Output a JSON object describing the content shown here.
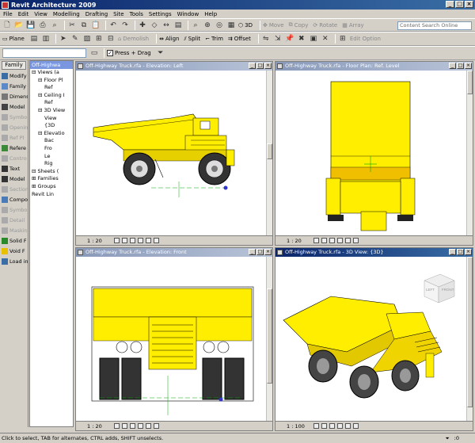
{
  "window": {
    "title": "Revit Architecture 2009"
  },
  "menu": [
    "File",
    "Edit",
    "View",
    "Modelling",
    "Drafting",
    "Site",
    "Tools",
    "Settings",
    "Window",
    "Help"
  ],
  "toolbar1": {
    "view_3d_label": "3D",
    "move_label": "Move",
    "copy_label": "Copy",
    "rotate_label": "Rotate",
    "array_label": "Array",
    "search_placeholder": "Content Search Online"
  },
  "toolbar2": {
    "plane_label": "Plane",
    "demolish_label": "Demolish",
    "align_label": "Align",
    "split_label": "Split",
    "trim_label": "Trim",
    "offset_label": "Offset",
    "edit_option_label": "Edit Option"
  },
  "toolbar3": {
    "press_drag_label": "Press + Drag"
  },
  "design_bar": {
    "tab": "Family",
    "items": [
      {
        "label": "Modify",
        "disabled": false,
        "color": "#3a6ea5"
      },
      {
        "label": "Family",
        "disabled": false,
        "color": "#5a8ac8"
      },
      {
        "label": "Dimens",
        "disabled": false,
        "color": "#777"
      },
      {
        "label": "Model",
        "disabled": false,
        "color": "#444"
      },
      {
        "label": "Symbo",
        "disabled": true,
        "color": "#aaa"
      },
      {
        "label": "Opening",
        "disabled": true,
        "color": "#aaa"
      },
      {
        "label": "Ref Pl",
        "disabled": true,
        "color": "#aaa"
      },
      {
        "label": "Refere",
        "disabled": false,
        "color": "#3a8a3a"
      },
      {
        "label": "Contro",
        "disabled": true,
        "color": "#aaa"
      },
      {
        "label": "Text",
        "disabled": false,
        "color": "#333"
      },
      {
        "label": "Model",
        "disabled": false,
        "color": "#333"
      },
      {
        "label": "Section",
        "disabled": true,
        "color": "#aaa"
      },
      {
        "label": "Compo",
        "disabled": false,
        "color": "#4a7ab8"
      },
      {
        "label": "Symbo",
        "disabled": true,
        "color": "#aaa"
      },
      {
        "label": "Detail",
        "disabled": true,
        "color": "#aaa"
      },
      {
        "label": "Maskin",
        "disabled": true,
        "color": "#aaa"
      },
      {
        "label": "Solid F",
        "disabled": false,
        "color": "#2a8a2a"
      },
      {
        "label": "Void F",
        "disabled": false,
        "color": "#e8c000"
      },
      {
        "label": "Load in",
        "disabled": false,
        "color": "#3a6ea5"
      }
    ]
  },
  "project_browser": {
    "title": "Off-Highwa",
    "tree": [
      {
        "label": "Views (a",
        "depth": 0,
        "marker": "⊟"
      },
      {
        "label": "Floor Pl",
        "depth": 1,
        "marker": "⊟"
      },
      {
        "label": "Ref",
        "depth": 2,
        "marker": ""
      },
      {
        "label": "Ceiling I",
        "depth": 1,
        "marker": "⊟"
      },
      {
        "label": "Ref",
        "depth": 2,
        "marker": ""
      },
      {
        "label": "3D View",
        "depth": 1,
        "marker": "⊟"
      },
      {
        "label": "View",
        "depth": 2,
        "marker": ""
      },
      {
        "label": "{3D",
        "depth": 2,
        "marker": ""
      },
      {
        "label": "Elevatio",
        "depth": 1,
        "marker": "⊟"
      },
      {
        "label": "Bac",
        "depth": 2,
        "marker": ""
      },
      {
        "label": "Fro",
        "depth": 2,
        "marker": ""
      },
      {
        "label": "Le",
        "depth": 2,
        "marker": ""
      },
      {
        "label": "Rig",
        "depth": 2,
        "marker": ""
      },
      {
        "label": "Sheets (",
        "depth": 0,
        "marker": "⊟"
      },
      {
        "label": "Families",
        "depth": 0,
        "marker": "⊞"
      },
      {
        "label": "Groups",
        "depth": 0,
        "marker": "⊞"
      },
      {
        "label": "Revit Lin",
        "depth": 0,
        "marker": ""
      }
    ]
  },
  "views": {
    "left": {
      "title": "Off-Highway Truck.rfa - Elevation: Left",
      "scale": "1 : 20"
    },
    "plan": {
      "title": "Off-Highway Truck.rfa - Floor Plan: Ref. Level",
      "scale": "1 : 20"
    },
    "front": {
      "title": "Off-Highway Truck.rfa - Elevation: Front",
      "scale": "1 : 20"
    },
    "view3d": {
      "title": "Off-Highway Truck.rfa - 3D View: {3D}",
      "scale": "1 : 100",
      "cube_left": "LEFT",
      "cube_front": "FRONT"
    }
  },
  "status": {
    "hint": "Click to select, TAB for alternates, CTRL adds, SHIFT unselects.",
    "count": ":0"
  },
  "colors": {
    "truck_yellow": "#ffee00",
    "title_active": "#0a246a",
    "title_inactive": "#8898b8"
  }
}
